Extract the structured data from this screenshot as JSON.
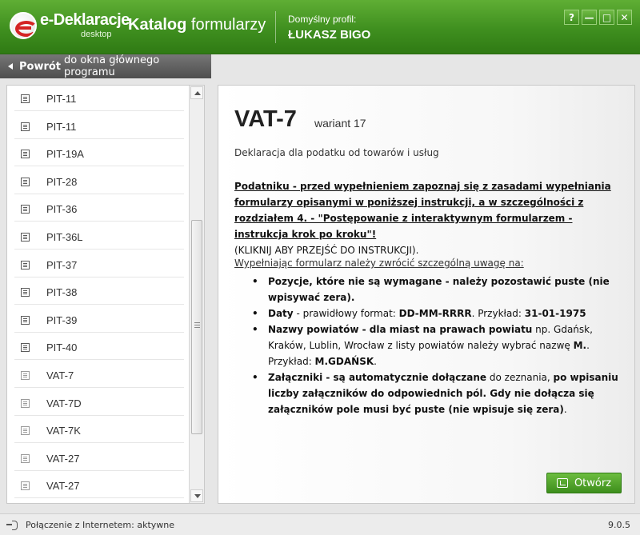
{
  "header": {
    "logo_title": "e-Deklaracje",
    "logo_sub": "desktop",
    "app_title_bold": "Katalog",
    "app_title_rest": " formularzy",
    "profile_label": "Domyślny profil:",
    "profile_name": "ŁUKASZ BIGO",
    "window_buttons": [
      "?",
      "—",
      "□",
      "✕"
    ]
  },
  "back": {
    "bold": "Powrót",
    "rest": "do okna głównego programu"
  },
  "list": {
    "items": [
      {
        "label": "PIT-11"
      },
      {
        "label": "PIT-11"
      },
      {
        "label": "PIT-19A"
      },
      {
        "label": "PIT-28"
      },
      {
        "label": "PIT-36"
      },
      {
        "label": "PIT-36L"
      },
      {
        "label": "PIT-37"
      },
      {
        "label": "PIT-38"
      },
      {
        "label": "PIT-39"
      },
      {
        "label": "PIT-40"
      },
      {
        "label": "VAT-7"
      },
      {
        "label": "VAT-7D"
      },
      {
        "label": "VAT-7K"
      },
      {
        "label": "VAT-27"
      },
      {
        "label": "VAT-27"
      }
    ]
  },
  "detail": {
    "name": "VAT-7",
    "variant": "wariant 17",
    "description": "Deklaracja dla podatku od towarów i usług",
    "instruction_link": "Podatniku - przed wypełnieniem zapoznaj się z zasadami wypełniania formularzy opisanymi w poniższej instrukcji, a w szczególności z rozdziałem 4. - \"Postępowanie z interaktywnym formularzem - instrukcja krok po kroku\"!",
    "instruction_hint": "(KLIKNIJ ABY PRZEJŚĆ DO INSTRUKCJI).",
    "note_title": "Wypełniając formularz należy zwrócić szczególną uwagę na:",
    "bullets": [
      {
        "b1": "Pozycje, które nie są wymagane - należy pozostawić puste (nie wpisywać zera).",
        "t1": "",
        "b2": "",
        "t2": "",
        "b3": ""
      },
      {
        "b1": "Daty",
        "t1": " - prawidłowy format: ",
        "b2": "DD-MM-RRRR",
        "t2": ". Przykład: ",
        "b3": "31-01-1975"
      },
      {
        "b1": "Nazwy powiatów - dla miast na prawach powiatu",
        "t1": " np. Gdańsk, Kraków, Lublin, Wrocław z listy powiatów należy wybrać nazwę ",
        "b2": "M.",
        "t2": ". Przykład: ",
        "b3": "M.GDAŃSK",
        "t3": "."
      },
      {
        "b1": "Załączniki - są automatycznie dołączane",
        "t1": " do zeznania, ",
        "b2": "po wpisaniu liczby załączników do odpowiednich pól. Gdy nie dołącza się załączników pole musi być puste (nie wpisuje się zera)",
        "t2": ".",
        "b3": ""
      }
    ],
    "open_button": "Otwórz"
  },
  "status": {
    "connection": "Połączenie z Internetem: aktywne",
    "version": "9.0.5"
  }
}
